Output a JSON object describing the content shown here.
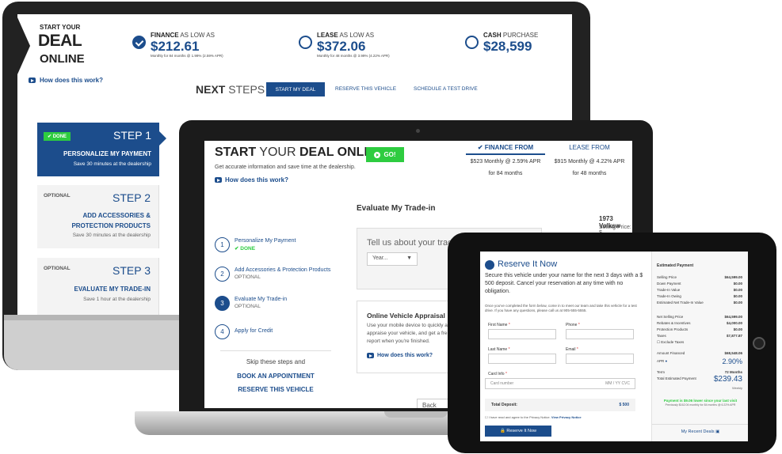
{
  "monitor": {
    "logo": {
      "line1": "START YOUR",
      "line2": "DEAL",
      "line3": "ONLINE"
    },
    "how_link": "How does this work?",
    "prices": [
      {
        "bold": "FINANCE",
        "rest": " AS LOW AS",
        "value": "$212.61",
        "sub": "Monthly for 84 months @ 1.99% (2.59% APR)",
        "selected": true
      },
      {
        "bold": "LEASE",
        "rest": " AS LOW AS",
        "value": "$372.06",
        "sub": "Monthly for 48 months @ 3.99% (4.22% APR)",
        "selected": false
      },
      {
        "bold": "CASH",
        "rest": " PURCHASE",
        "value": "$28,599",
        "sub": "",
        "selected": false
      }
    ],
    "next_steps": {
      "bold": "NEXT",
      "rest": " STEPS",
      "start_btn": "START MY DEAL",
      "reserve": "RESERVE THIS VEHICLE",
      "test_drive": "SCHEDULE A TEST DRIVE"
    },
    "steps": [
      {
        "badge": "DONE",
        "num": "STEP 1",
        "title1": "PERSONALIZE MY PAYMENT",
        "title2": "",
        "sub": "Save 30 minutes at the dealership"
      },
      {
        "badge": "OPTIONAL",
        "num": "STEP 2",
        "title1": "ADD ACCESSORIES &",
        "title2": "PROTECTION PRODUCTS",
        "sub": "Save 30 minutes at the dealership"
      },
      {
        "badge": "OPTIONAL",
        "num": "STEP 3",
        "title1": "EVALUATE MY TRADE-IN",
        "title2": "",
        "sub": "Save 1 hour at the dealership"
      }
    ]
  },
  "laptop": {
    "title_a": "START",
    "title_b": " YOUR ",
    "title_c": "DEAL ONLINE",
    "go": "GO!",
    "subtitle": "Get accurate information and save time at the dealership.",
    "how": "How does this work?",
    "finance_tab": {
      "label": "FINANCE FROM",
      "line1": "$523 Monthly @ 2.59% APR",
      "line2": "for 84 months"
    },
    "lease_tab": {
      "label": "LEASE FROM",
      "line1": "$915 Monthly @ 4.22% APR",
      "line2": "for 48 months"
    },
    "vsteps": [
      {
        "n": "1",
        "label": "Personalize My Payment",
        "sub": "✔ DONE"
      },
      {
        "n": "2",
        "label": "Add Accessories & Protection Products",
        "sub": "OPTIONAL"
      },
      {
        "n": "3",
        "label": "Evaluate My Trade-in",
        "sub": "OPTIONAL"
      },
      {
        "n": "4",
        "label": "Apply for Credit",
        "sub": ""
      }
    ],
    "skip": "Skip these steps and",
    "book": "BOOK AN APPOINTMENT",
    "reserve": "RESERVE THIS VEHICLE",
    "eval_title": "Evaluate My Trade-in",
    "trade_q": "Tell us about your trad",
    "year_placeholder": "Year...",
    "ova_title": "Online Vehicle Appraisal",
    "ova_desc": "Use your mobile device to quickly a appraise your vehicle, and get a fre report when you're finished.",
    "ova_how": "How does this work?",
    "back": "Back to",
    "car_title": "1973 Volksw",
    "car_price": "Selling Price: $"
  },
  "tablet": {
    "title": "Reserve It Now",
    "desc": "Secure this vehicle under your name for the next 3 days with a $ 500 deposit. Cancel your reservation at any time with no obligation.",
    "small": "Once you've completed the form below, come in to meet our team and take this vehicle for a test drive. If you have any questions, please call us at 905-555-5555.",
    "first_name": "First Name",
    "phone": "Phone",
    "last_name": "Last Name",
    "email": "Email",
    "card_info": "Card Info",
    "card_placeholder": "Card number",
    "card_exp": "MM / YY  CVC",
    "total_deposit": "Total Deposit:",
    "deposit_val": "$ 500",
    "agree": "I have read and agree to the Privacy Notice.",
    "privacy": "View Privacy Notice",
    "btn": "Reserve It Now",
    "summary": {
      "heading": "Estimated Payment",
      "rows": [
        {
          "l": "Selling Price",
          "v": "$64,599.00"
        },
        {
          "l": "Down Payment",
          "v": "$0.00"
        },
        {
          "l": "Trade-In Value",
          "v": "$0.00"
        },
        {
          "l": "Trade-In Owing",
          "v": "$0.00"
        },
        {
          "l": "Estimated Net Trade-In Value",
          "v": "$0.00"
        },
        {
          "l": "Net Selling Price",
          "v": "$64,599.00"
        },
        {
          "l": "Rebates & Incentives",
          "v": "$4,000.00"
        },
        {
          "l": "Protection Products",
          "v": "$0.00"
        },
        {
          "l": "Taxes",
          "v": "$7,877.87"
        },
        {
          "l": "Exclude Taxes",
          "v": ""
        },
        {
          "l": "Amount Financed",
          "v": "$68,548.06"
        }
      ],
      "apr_label": "APR",
      "apr": "2.90%",
      "term_label": "Term",
      "term": "72 Months",
      "est_label": "Total Estimated Payment",
      "est": "$239.43",
      "weekly": "Weekly",
      "green": "Payment is $9.06 lower since your last visit",
      "green_sub": "Previously $162.04 monthly for 84 months @ 6.22% APR",
      "recent": "My Recent Deals"
    }
  }
}
